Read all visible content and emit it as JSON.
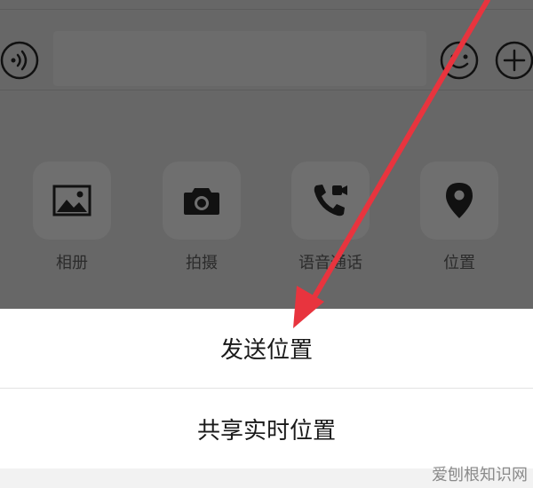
{
  "input_bar": {
    "voice_icon": "voice-wave-icon",
    "emoji_icon": "smiley-icon",
    "plus_icon": "plus-circle-icon"
  },
  "tools": [
    {
      "label": "相册",
      "icon": "image-icon"
    },
    {
      "label": "拍摄",
      "icon": "camera-icon"
    },
    {
      "label": "语音通话",
      "icon": "phone-video-icon"
    },
    {
      "label": "位置",
      "icon": "location-pin-icon"
    }
  ],
  "sheet": {
    "send_location": "发送位置",
    "share_live_location": "共享实时位置"
  },
  "watermark": "爱刨根知识网",
  "colors": {
    "overlay": "#676767",
    "sheet": "#ffffff",
    "arrow": "#e8343e"
  }
}
